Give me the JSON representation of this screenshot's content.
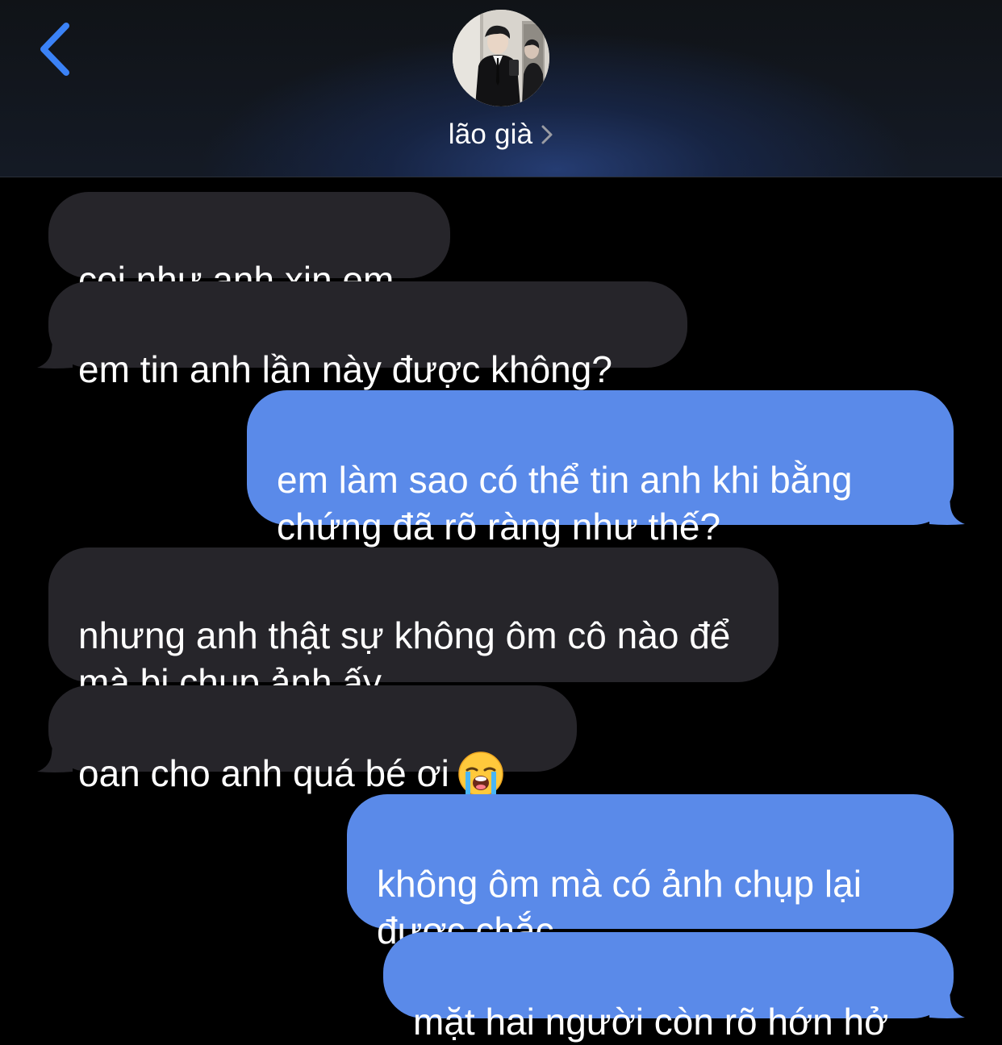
{
  "header": {
    "contact_name": "lão già"
  },
  "icons": {
    "back": "chevron-left-icon",
    "contact_detail": "chevron-right-icon",
    "emoji": "loudly-crying-face-emoji"
  },
  "colors": {
    "accent": "#3b82f6",
    "incoming_bubble": "#26252a",
    "outgoing_bubble": "#5a8ae9",
    "background": "#000000"
  },
  "messages": [
    {
      "sender": "them",
      "text": "coi như anh xin em"
    },
    {
      "sender": "them",
      "text": "em tin anh lần này được không?"
    },
    {
      "sender": "me",
      "text": "em làm sao có thể tin anh khi bằng chứng đã rõ ràng như thế?"
    },
    {
      "sender": "them",
      "text": "nhưng anh thật sự không ôm cô nào để mà bị chụp ảnh ấy"
    },
    {
      "sender": "them",
      "text": "oan cho anh quá bé ơi",
      "emoji": "😭"
    },
    {
      "sender": "me",
      "text": "không ôm mà có ảnh chụp lại được chắc"
    },
    {
      "sender": "me",
      "text": "mặt hai người còn rõ hớn hở"
    }
  ]
}
